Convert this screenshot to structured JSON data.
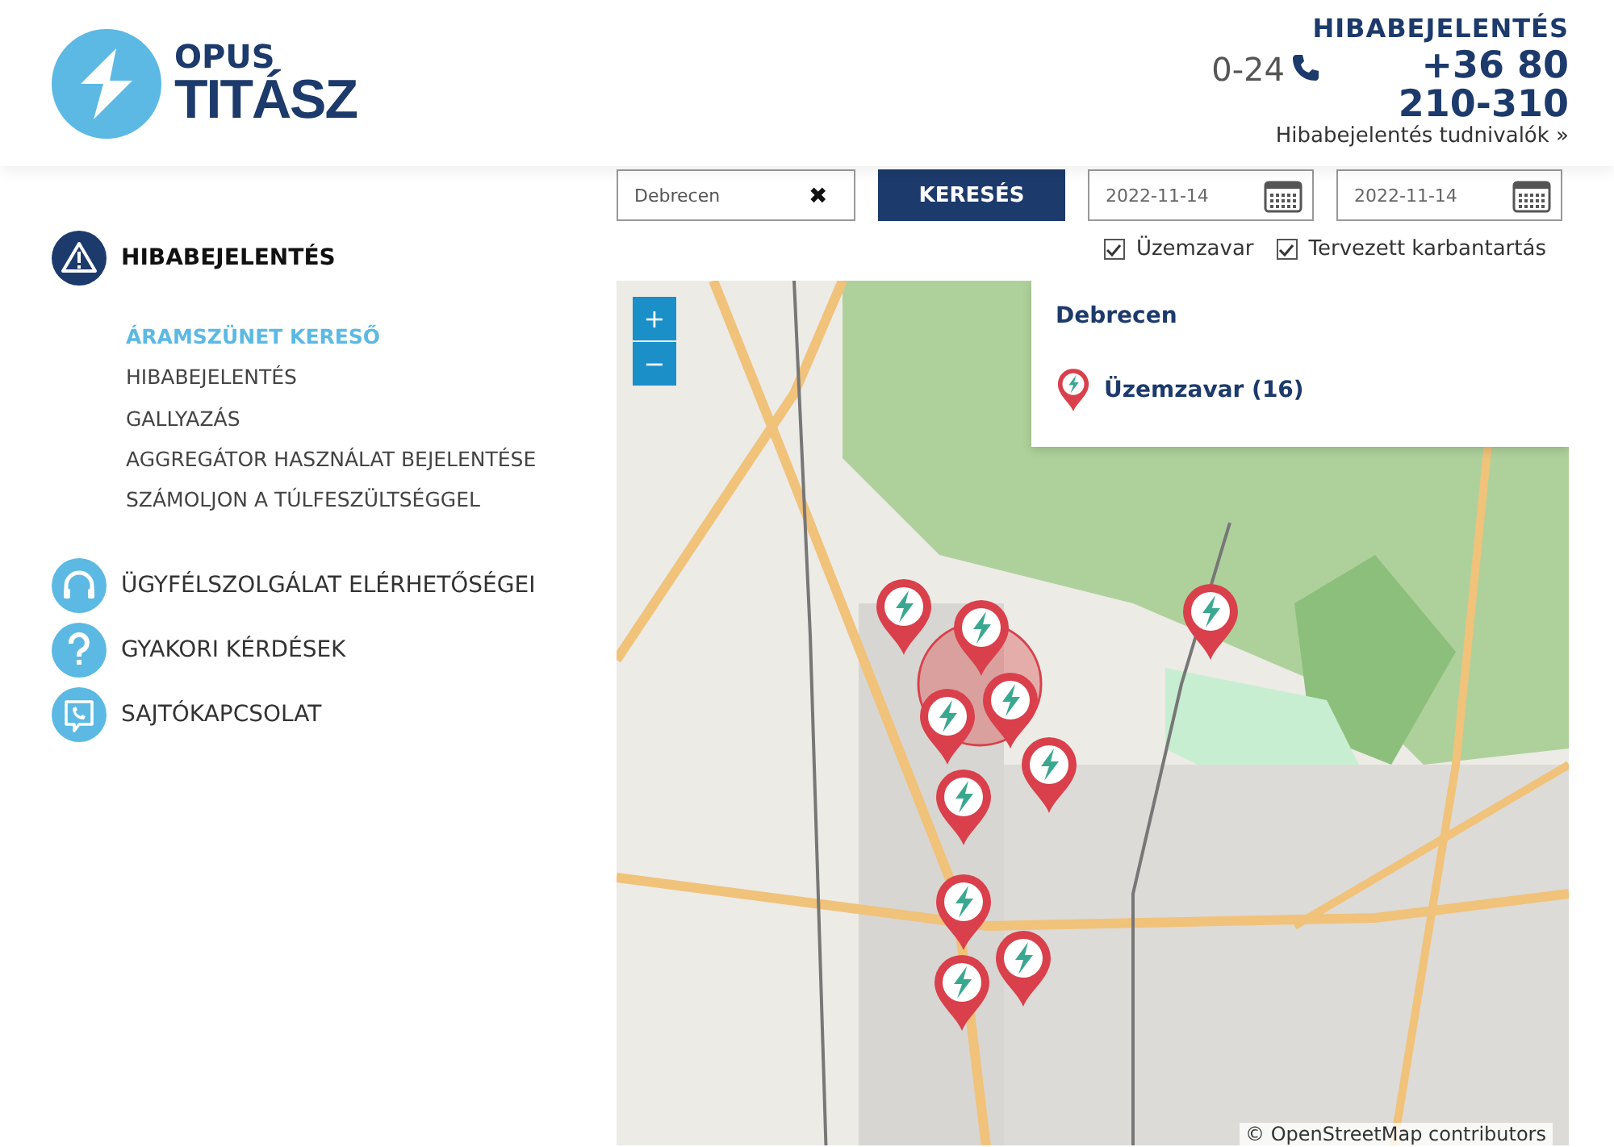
{
  "header": {
    "logo": {
      "line_1": "OPUS",
      "line_2": "TITÁSZ"
    },
    "hotline": {
      "title": "HIBABEJELENTÉS",
      "hours": "0-24",
      "phone": "+36 80 210-310",
      "link": "Hibabejelentés tudnivalók »"
    }
  },
  "sidebar": {
    "sections": [
      {
        "label": "HIBABEJELENTÉS",
        "kind": "alert",
        "expanded": true,
        "items": [
          {
            "label": "ÁRAMSZÜNET KERESŐ",
            "selected": true
          },
          {
            "label": "HIBABEJELENTÉS",
            "selected": false
          },
          {
            "label": "GALLYAZÁS",
            "selected": false
          },
          {
            "label": "AGGREGÁTOR HASZNÁLAT BEJELENTÉSE",
            "selected": false
          },
          {
            "label": "SZÁMOLJON A TÚLFESZÜLTSÉGGEL",
            "selected": false
          }
        ]
      },
      {
        "label": "ÜGYFÉLSZOLGÁLAT ELÉRHETŐSÉGEI",
        "kind": "headset",
        "expanded": false
      },
      {
        "label": "GYAKORI KÉRDÉSEK",
        "kind": "question",
        "expanded": false
      },
      {
        "label": "SAJTÓKAPCSOLAT",
        "kind": "phone",
        "expanded": false
      }
    ]
  },
  "search": {
    "city": "Debrecen",
    "clear": "✖",
    "button": "KERESÉS",
    "date_from": "2022-11-14",
    "date_to": "2022-11-14"
  },
  "filters": [
    {
      "label": "Üzemzavar",
      "checked": true
    },
    {
      "label": "Tervezett karbantartás",
      "checked": true
    }
  ],
  "map": {
    "zoom_in": "+",
    "zoom_out": "−",
    "legend": {
      "city": "Debrecen",
      "entry": "Üzemzavar (16)"
    },
    "attribution": "© OpenStreetMap contributors"
  }
}
